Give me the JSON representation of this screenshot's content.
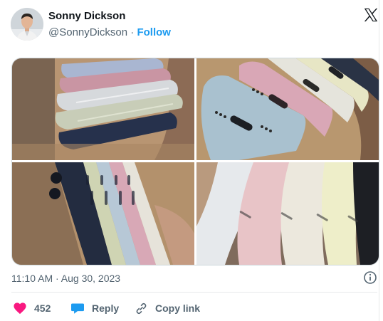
{
  "author": {
    "name": "Sonny Dickson",
    "handle": "@SonnyDickson",
    "separator": "·",
    "follow_label": "Follow"
  },
  "platform_icon": "x-logo-icon",
  "media": {
    "tiles": [
      {
        "icon": "photo",
        "subject": "stacked-phones-side"
      },
      {
        "icon": "photo",
        "subject": "phones-bottom-ports"
      },
      {
        "icon": "photo",
        "subject": "phones-side-buttons"
      },
      {
        "icon": "photo",
        "subject": "phones-corner-fan"
      }
    ]
  },
  "timestamp": "11:10 AM · Aug 30, 2023",
  "actions": {
    "like_count": "452",
    "reply_label": "Reply",
    "copy_link_label": "Copy link"
  },
  "colors": {
    "like": "#f91880",
    "reply": "#1d9bf0",
    "follow": "#1d9bf0",
    "secondary_text": "#536471"
  }
}
